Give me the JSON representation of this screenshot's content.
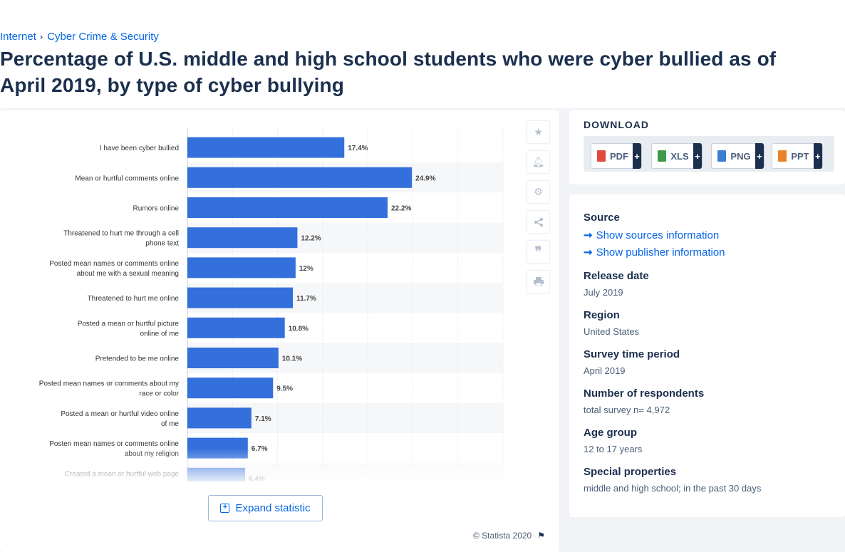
{
  "breadcrumb": {
    "items": [
      "Internet",
      "Cyber Crime & Security"
    ],
    "separator": "›"
  },
  "page_title": "Percentage of U.S. middle and high school students who were cyber bullied as of April 2019, by type of cyber bullying",
  "chart_data": {
    "type": "bar",
    "orientation": "horizontal",
    "categories": [
      "I have been cyber bullied",
      "Mean or hurtful comments online",
      "Rumors online",
      "Threatened to hurt me through a cell phone text",
      "Posted mean names or comments online about me with a sexual meaning",
      "Threatened to hurt me online",
      "Posted a mean or hurtful picture online of me",
      "Pretended to be me online",
      "Posted mean names or comments about my race or color",
      "Posted a mean or hurtful video online of me",
      "Posten mean names or comments online about my religion",
      "Created a mean or hurtful web page about"
    ],
    "values": [
      17.4,
      24.9,
      22.2,
      12.2,
      12,
      11.7,
      10.8,
      10.1,
      9.5,
      7.1,
      6.7,
      6.4
    ],
    "value_labels": [
      "17.4%",
      "24.9%",
      "22.2%",
      "12.2%",
      "12%",
      "11.7%",
      "10.8%",
      "10.1%",
      "9.5%",
      "7.1%",
      "6.7%",
      "6.4%"
    ],
    "xlim": [
      0,
      35
    ],
    "grid": true,
    "bar_color": "#3470db"
  },
  "expand_label": "Expand statistic",
  "copyright": "© Statista 2020",
  "tool_icons": [
    "star-icon",
    "bell-icon",
    "gear-icon",
    "share-icon",
    "quote-icon",
    "print-icon"
  ],
  "download": {
    "title": "DOWNLOAD",
    "buttons": [
      {
        "label": "PDF",
        "plus": "+",
        "color": "#e04a3f"
      },
      {
        "label": "XLS",
        "plus": "+",
        "color": "#3f9b4a"
      },
      {
        "label": "PNG",
        "plus": "+",
        "color": "#3b7ed1"
      },
      {
        "label": "PPT",
        "plus": "+",
        "color": "#e8832a"
      }
    ]
  },
  "info": {
    "source_heading": "Source",
    "show_sources": "Show sources information",
    "show_publisher": "Show publisher information",
    "release_heading": "Release date",
    "release_value": "July 2019",
    "region_heading": "Region",
    "region_value": "United States",
    "survey_heading": "Survey time period",
    "survey_value": "April 2019",
    "respondents_heading": "Number of respondents",
    "respondents_value": "total survey n= 4,972",
    "age_heading": "Age group",
    "age_value": "12 to 17 years",
    "special_heading": "Special properties",
    "special_value": "middle and high school; in the past 30 days"
  }
}
